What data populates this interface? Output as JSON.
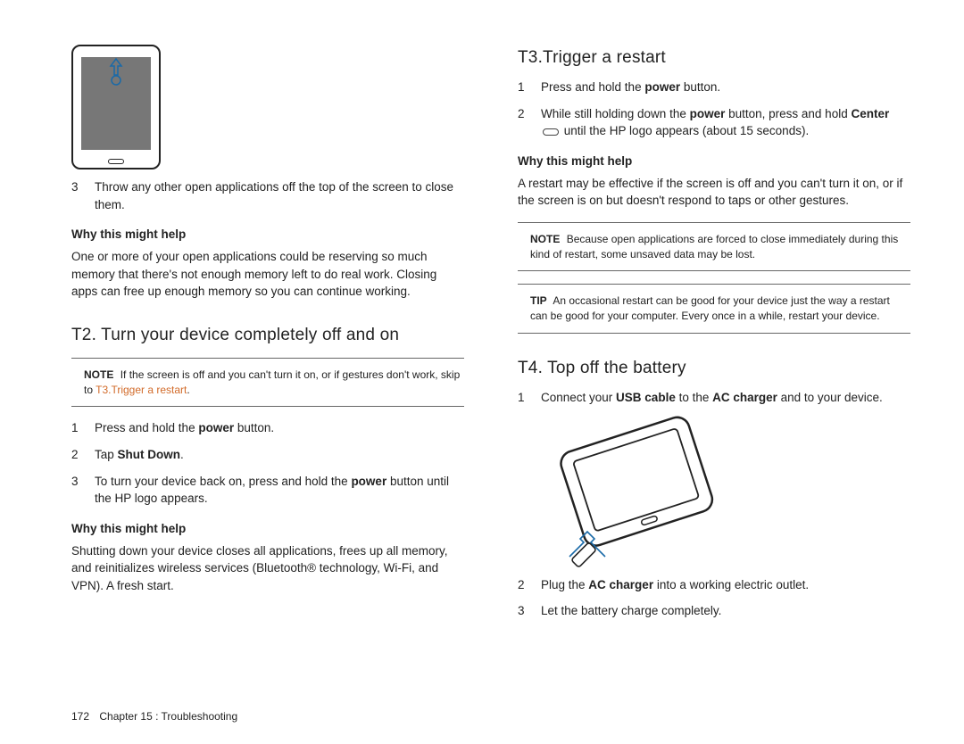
{
  "left": {
    "step3_num": "3",
    "step3_text": "Throw any other open applications off the top of the screen to close them.",
    "why1_head": "Why this might help",
    "why1_body": "One or more of your open applications could be reserving so much memory that there's not enough memory left to do real work. Closing apps can free up enough memory so you can continue working.",
    "t2_title": "T2. Turn your device completely off and on",
    "t2_note_tag": "NOTE",
    "t2_note_text": "If the screen is off and you can't turn it on, or if gestures don't work, skip to ",
    "t2_note_link": "T3.Trigger a restart",
    "t2_s1_n": "1",
    "t2_s1_a": "Press and hold the ",
    "t2_s1_b": "power",
    "t2_s1_c": " button.",
    "t2_s2_n": "2",
    "t2_s2_a": "Tap ",
    "t2_s2_b": "Shut Down",
    "t2_s2_c": ".",
    "t2_s3_n": "3",
    "t2_s3_a": "To turn your device back on, press and hold the ",
    "t2_s3_b": "power",
    "t2_s3_c": " button until the HP logo appears.",
    "why2_head": "Why this might help",
    "why2_body": "Shutting down your device closes all applications, frees up all memory, and reinitializes wireless services (Bluetooth® technology, Wi-Fi, and VPN). A fresh start."
  },
  "right": {
    "t3_title": "T3.Trigger a restart",
    "t3_s1_n": "1",
    "t3_s1_a": "Press and hold the ",
    "t3_s1_b": "power",
    "t3_s1_c": " button.",
    "t3_s2_n": "2",
    "t3_s2_a": "While still holding down the ",
    "t3_s2_b": "power",
    "t3_s2_c": " button, press and hold ",
    "t3_s2_d": "Center",
    "t3_s2_e": " until the HP logo appears (about 15 seconds).",
    "why3_head": "Why this might help",
    "why3_body": "A restart may be effective if the screen is off and you can't turn it on, or if the screen is on but doesn't respond to taps or other gestures.",
    "note2_tag": "NOTE",
    "note2_text": "Because open applications are forced to close immediately during this kind of restart, some unsaved data may be lost.",
    "tip_tag": "TIP",
    "tip_text": "An occasional restart can be good for your device just the way a restart can be good for your computer. Every once in a while, restart your device.",
    "t4_title": "T4. Top off the battery",
    "t4_s1_n": "1",
    "t4_s1_a": "Connect your ",
    "t4_s1_b": "USB cable",
    "t4_s1_c": " to the ",
    "t4_s1_d": "AC charger",
    "t4_s1_e": " and to your device.",
    "t4_s2_n": "2",
    "t4_s2_a": "Plug the ",
    "t4_s2_b": "AC charger",
    "t4_s2_c": " into a working electric outlet.",
    "t4_s3_n": "3",
    "t4_s3_text": "Let the battery charge completely."
  },
  "footer": {
    "page": "172",
    "chapter": "Chapter 15 : Troubleshooting"
  }
}
